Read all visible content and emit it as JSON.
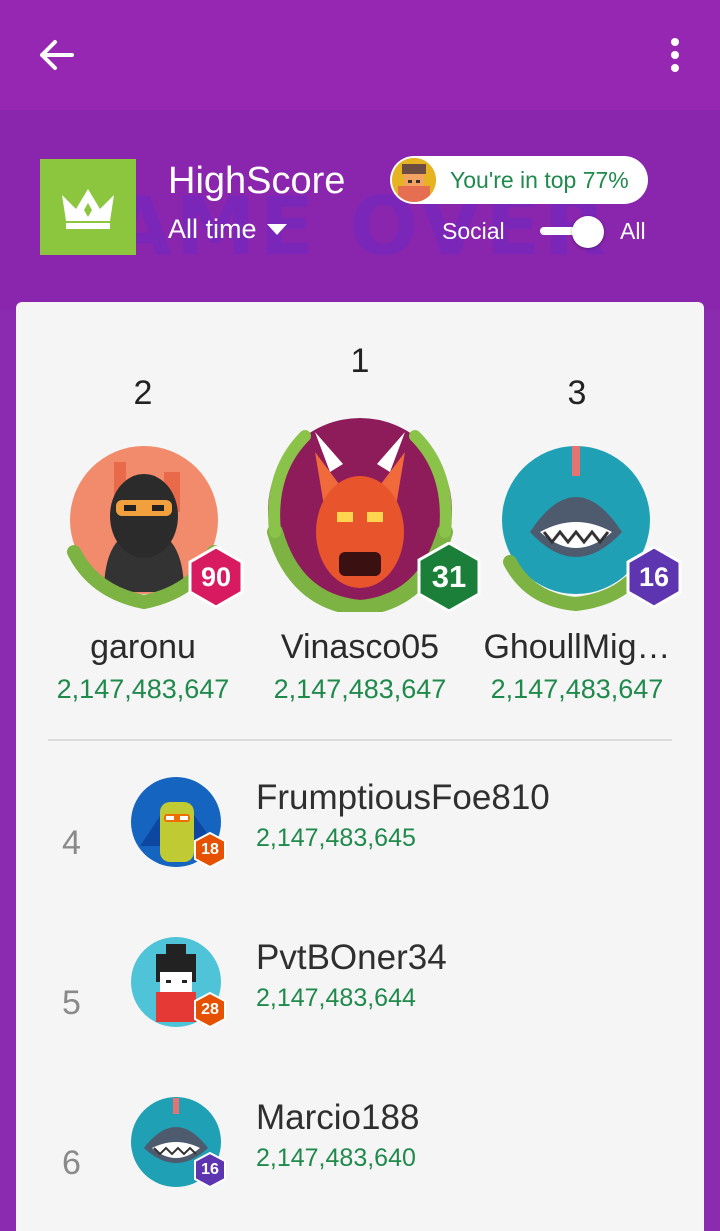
{
  "header": {
    "game_title": "HighScore",
    "time_filter": "All time",
    "rank_pill": "You're in top 77%",
    "toggle_left": "Social",
    "toggle_right": "All",
    "background_art_text": "GAME OVER"
  },
  "podium": [
    {
      "place": "2",
      "name": "garonu",
      "score": "2,147,483,647",
      "level": "90",
      "badge_color": "#d81b60",
      "avatar": "ninja-avatar"
    },
    {
      "place": "1",
      "name": "Vinasco05",
      "score": "2,147,483,647",
      "level": "31",
      "badge_color": "#1b7f3a",
      "avatar": "dragon-avatar"
    },
    {
      "place": "3",
      "name": "GhoullMig…",
      "score": "2,147,483,647",
      "level": "16",
      "badge_color": "#5e35b1",
      "avatar": "shark-avatar"
    }
  ],
  "rows": [
    {
      "rank": "4",
      "name": "FrumptiousFoe810",
      "score": "2,147,483,645",
      "level": "18",
      "badge_color": "#e65100",
      "avatar": "llama-avatar"
    },
    {
      "rank": "5",
      "name": "PvtBOner34",
      "score": "2,147,483,644",
      "level": "28",
      "badge_color": "#e65100",
      "avatar": "kokeshi-avatar"
    },
    {
      "rank": "6",
      "name": "Marcio188",
      "score": "2,147,483,640",
      "level": "16",
      "badge_color": "#5e35b1",
      "avatar": "shark-avatar"
    }
  ],
  "colors": {
    "topbar": "#9627b3",
    "header": "#8a25ad",
    "crown_tile": "#8cc63f",
    "score_green": "#1f8a4c"
  }
}
